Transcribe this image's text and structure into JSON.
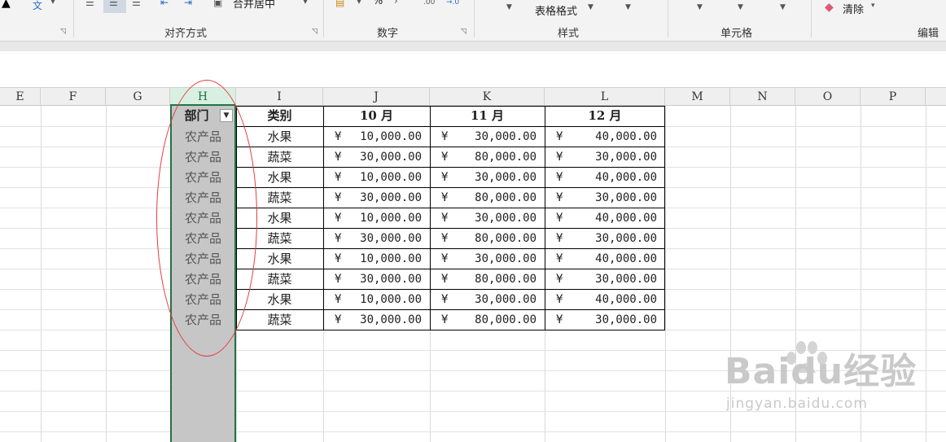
{
  "ribbon": {
    "font_glyph": "文",
    "merge_label": "合并居中",
    "percent_glyph": "%",
    "decimal_glyph_1": ".00",
    "decimal_glyph_2": "→.0",
    "table_format_label": "表格格式",
    "clear_label": "清除",
    "groups": {
      "alignment": "对齐方式",
      "number": "数字",
      "styles": "样式",
      "cells": "单元格",
      "editing": "编辑"
    }
  },
  "columns": [
    "E",
    "F",
    "G",
    "H",
    "I",
    "J",
    "K",
    "L",
    "M",
    "N",
    "O",
    "P"
  ],
  "selected_column": "H",
  "table": {
    "headers": [
      "部门",
      "类别",
      "10 月",
      "11 月",
      "12 月"
    ],
    "currency_symbol": "¥",
    "rows": [
      {
        "dept": "农产品",
        "cat": "水果",
        "m10": "10,000.00",
        "m11": "30,000.00",
        "m12": "40,000.00"
      },
      {
        "dept": "农产品",
        "cat": "蔬菜",
        "m10": "30,000.00",
        "m11": "80,000.00",
        "m12": "30,000.00"
      },
      {
        "dept": "农产品",
        "cat": "水果",
        "m10": "10,000.00",
        "m11": "30,000.00",
        "m12": "40,000.00"
      },
      {
        "dept": "农产品",
        "cat": "蔬菜",
        "m10": "30,000.00",
        "m11": "80,000.00",
        "m12": "30,000.00"
      },
      {
        "dept": "农产品",
        "cat": "水果",
        "m10": "10,000.00",
        "m11": "30,000.00",
        "m12": "40,000.00"
      },
      {
        "dept": "农产品",
        "cat": "蔬菜",
        "m10": "30,000.00",
        "m11": "80,000.00",
        "m12": "30,000.00"
      },
      {
        "dept": "农产品",
        "cat": "水果",
        "m10": "10,000.00",
        "m11": "30,000.00",
        "m12": "40,000.00"
      },
      {
        "dept": "农产品",
        "cat": "蔬菜",
        "m10": "30,000.00",
        "m11": "80,000.00",
        "m12": "30,000.00"
      },
      {
        "dept": "农产品",
        "cat": "水果",
        "m10": "10,000.00",
        "m11": "30,000.00",
        "m12": "40,000.00"
      },
      {
        "dept": "农产品",
        "cat": "蔬菜",
        "m10": "30,000.00",
        "m11": "80,000.00",
        "m12": "30,000.00"
      }
    ]
  },
  "watermark": {
    "brand": "Baidu经验",
    "url": "jingyan.baidu.com"
  },
  "colors": {
    "selection_green": "#217346",
    "annotation_red": "#e23b3b"
  },
  "icons": [
    "align-left-icon",
    "align-center-icon",
    "align-right-icon",
    "indent-decrease-icon",
    "indent-increase-icon",
    "merge-icon",
    "currency-icon",
    "eraser-icon",
    "filter-icon",
    "dialog-launcher-icon"
  ]
}
